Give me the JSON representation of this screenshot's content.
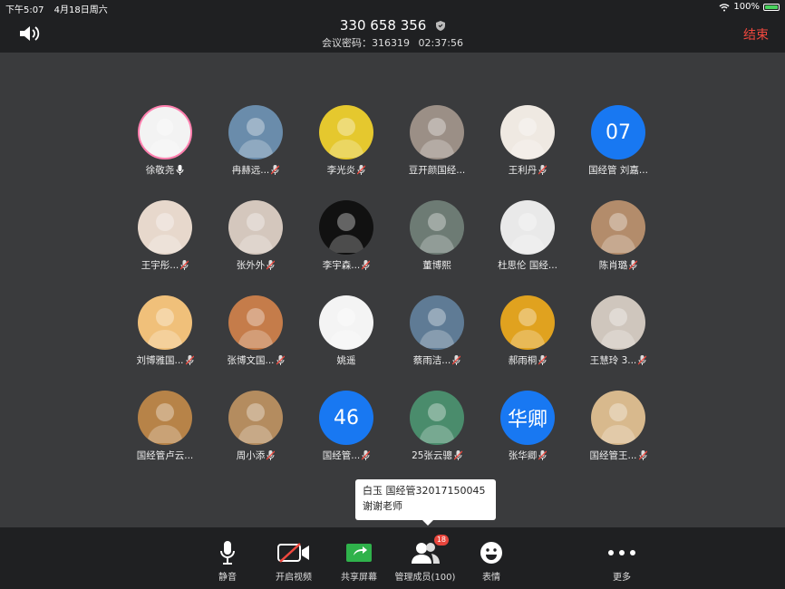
{
  "status": {
    "time": "下午5:07",
    "date": "4月18日周六",
    "battery": "100%",
    "battery_level": 1.0
  },
  "header": {
    "meeting_id": "330 658 356",
    "password_label": "会议密码：316319",
    "elapsed": "02:37:56",
    "end": "结束"
  },
  "participants": [
    {
      "name": "徐敬尧",
      "avatar": "photo",
      "bg": "#f3f3f3",
      "ring": true,
      "mic": "on"
    },
    {
      "name": "冉赫远...",
      "avatar": "photo",
      "bg": "#6a8cab",
      "mic": "muted"
    },
    {
      "name": "李光炎",
      "avatar": "photo",
      "bg": "#e5c82e",
      "mic": "muted"
    },
    {
      "name": "豆开颜国经...",
      "avatar": "photo",
      "bg": "#9b8f86",
      "mic": "none"
    },
    {
      "name": "王利丹",
      "avatar": "photo",
      "bg": "#efe9e2",
      "mic": "muted"
    },
    {
      "name": "国经管 刘嘉...",
      "avatar": "text",
      "text": "07",
      "bg": "#1878f2",
      "mic": "none"
    },
    {
      "name": "王宇彤...",
      "avatar": "photo",
      "bg": "#e7d8cc",
      "mic": "muted"
    },
    {
      "name": "张外外",
      "avatar": "photo",
      "bg": "#d4c7bd",
      "mic": "muted"
    },
    {
      "name": "李宇森...",
      "avatar": "photo",
      "bg": "#111111",
      "mic": "muted"
    },
    {
      "name": "董博熙",
      "avatar": "photo",
      "bg": "#6d7b74",
      "mic": "none"
    },
    {
      "name": "杜思伦 国经...",
      "avatar": "photo",
      "bg": "#e9e9e9",
      "mic": "none"
    },
    {
      "name": "陈肖璐",
      "avatar": "photo",
      "bg": "#b38c6b",
      "mic": "muted"
    },
    {
      "name": "刘博雅国...",
      "avatar": "photo",
      "bg": "#f0c07a",
      "mic": "muted"
    },
    {
      "name": "张博文国...",
      "avatar": "photo",
      "bg": "#c57c4a",
      "mic": "muted"
    },
    {
      "name": "姚遥",
      "avatar": "photo",
      "bg": "#f4f4f4",
      "mic": "none"
    },
    {
      "name": "蔡雨洁...",
      "avatar": "photo",
      "bg": "#5f7b95",
      "mic": "muted"
    },
    {
      "name": "郝雨桐",
      "avatar": "photo",
      "bg": "#e0a21f",
      "mic": "muted"
    },
    {
      "name": "王慧玲 3...",
      "avatar": "photo",
      "bg": "#cfc6bd",
      "mic": "muted"
    },
    {
      "name": "国经管卢云...",
      "avatar": "photo",
      "bg": "#b78348",
      "mic": "none"
    },
    {
      "name": "周小添",
      "avatar": "photo",
      "bg": "#b48c5f",
      "mic": "muted"
    },
    {
      "name": "国经管...",
      "avatar": "text",
      "text": "46",
      "bg": "#1878f2",
      "mic": "muted"
    },
    {
      "name": "25张云骢",
      "avatar": "photo",
      "bg": "#4a8c6c",
      "mic": "muted"
    },
    {
      "name": "张华卿",
      "avatar": "text",
      "text": "华卿",
      "bg": "#1878f2",
      "mic": "muted"
    },
    {
      "name": "国经管王...",
      "avatar": "photo",
      "bg": "#d8b98d",
      "mic": "muted"
    }
  ],
  "chat_bubble": {
    "sender": "白玉 国经管32017150045",
    "message": "谢谢老师"
  },
  "toolbar": {
    "mute": "静音",
    "video": "开启视频",
    "share": "共享屏幕",
    "members": "管理成员(100)",
    "members_badge": "18",
    "emoji": "表情",
    "more": "更多"
  },
  "colors": {
    "accent": "#1878f2",
    "end": "#f0483e",
    "share": "#2fb24b"
  }
}
